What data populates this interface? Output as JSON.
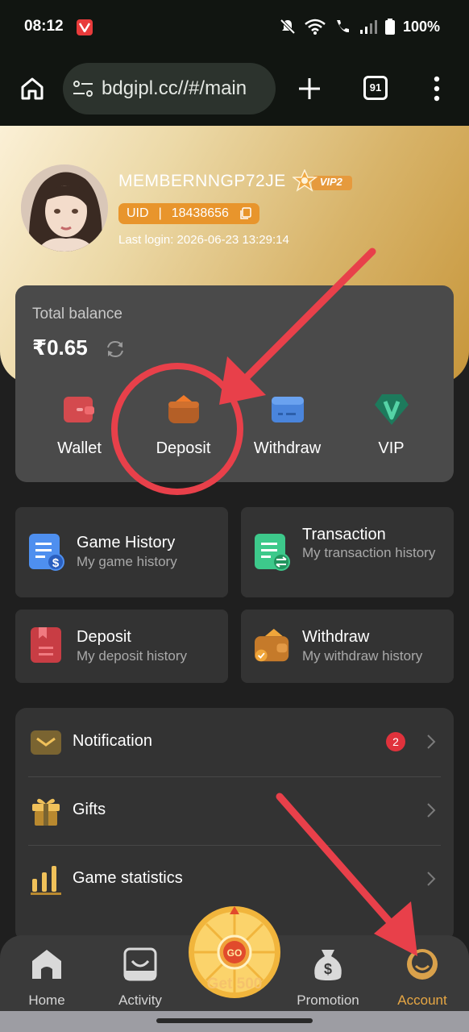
{
  "status_bar": {
    "time": "08:12",
    "battery": "100%"
  },
  "browser": {
    "url": "bdgipl.cc//#/main",
    "tab_count": "91"
  },
  "profile": {
    "username": "MEMBERNNGP72JE",
    "vip_label": "VIP2",
    "uid_label": "UID",
    "uid_separator": "|",
    "uid": "18438656",
    "last_login": "Last login: 2026-06-23 13:29:14"
  },
  "balance": {
    "title": "Total balance",
    "amount": "₹0.65",
    "actions": [
      {
        "label": "Wallet",
        "icon": "wallet-icon"
      },
      {
        "label": "Deposit",
        "icon": "deposit-icon"
      },
      {
        "label": "Withdraw",
        "icon": "withdraw-card-icon"
      },
      {
        "label": "VIP",
        "icon": "vip-icon"
      }
    ]
  },
  "history": [
    {
      "title": "Game History",
      "subtitle": "My game history",
      "icon": "game-history-icon"
    },
    {
      "title": "Transaction",
      "subtitle": "My transaction history",
      "icon": "transaction-icon"
    },
    {
      "title": "Deposit",
      "subtitle": "My deposit history",
      "icon": "deposit-history-icon"
    },
    {
      "title": "Withdraw",
      "subtitle": "My withdraw history",
      "icon": "withdraw-history-icon"
    }
  ],
  "settings": [
    {
      "label": "Notification",
      "badge": "2",
      "icon": "notification-icon"
    },
    {
      "label": "Gifts",
      "icon": "gift-icon"
    },
    {
      "label": "Game statistics",
      "icon": "statistics-icon"
    }
  ],
  "bottom_nav": {
    "home": "Home",
    "activity": "Activity",
    "center": "Get 500",
    "wheel_text": "GO",
    "promotion": "Promotion",
    "account": "Account"
  },
  "colors": {
    "accent": "#e7a744",
    "annotation": "#e8404a",
    "card": "#4a4a4a",
    "background": "#1f1f1f"
  }
}
